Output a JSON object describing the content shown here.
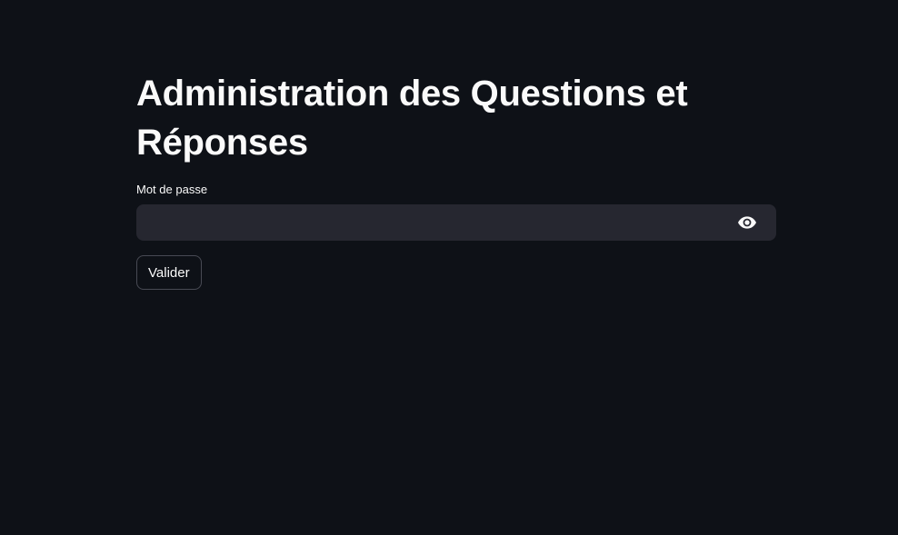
{
  "page": {
    "title": "Administration des Questions et Réponses"
  },
  "form": {
    "password_label": "Mot de passe",
    "password_value": "",
    "password_placeholder": "",
    "toggle_icon": "eye-icon",
    "submit_label": "Valider"
  },
  "colors": {
    "background": "#0e1117",
    "input_background": "#262730",
    "text": "#fafafa",
    "button_border": "#484a54"
  }
}
